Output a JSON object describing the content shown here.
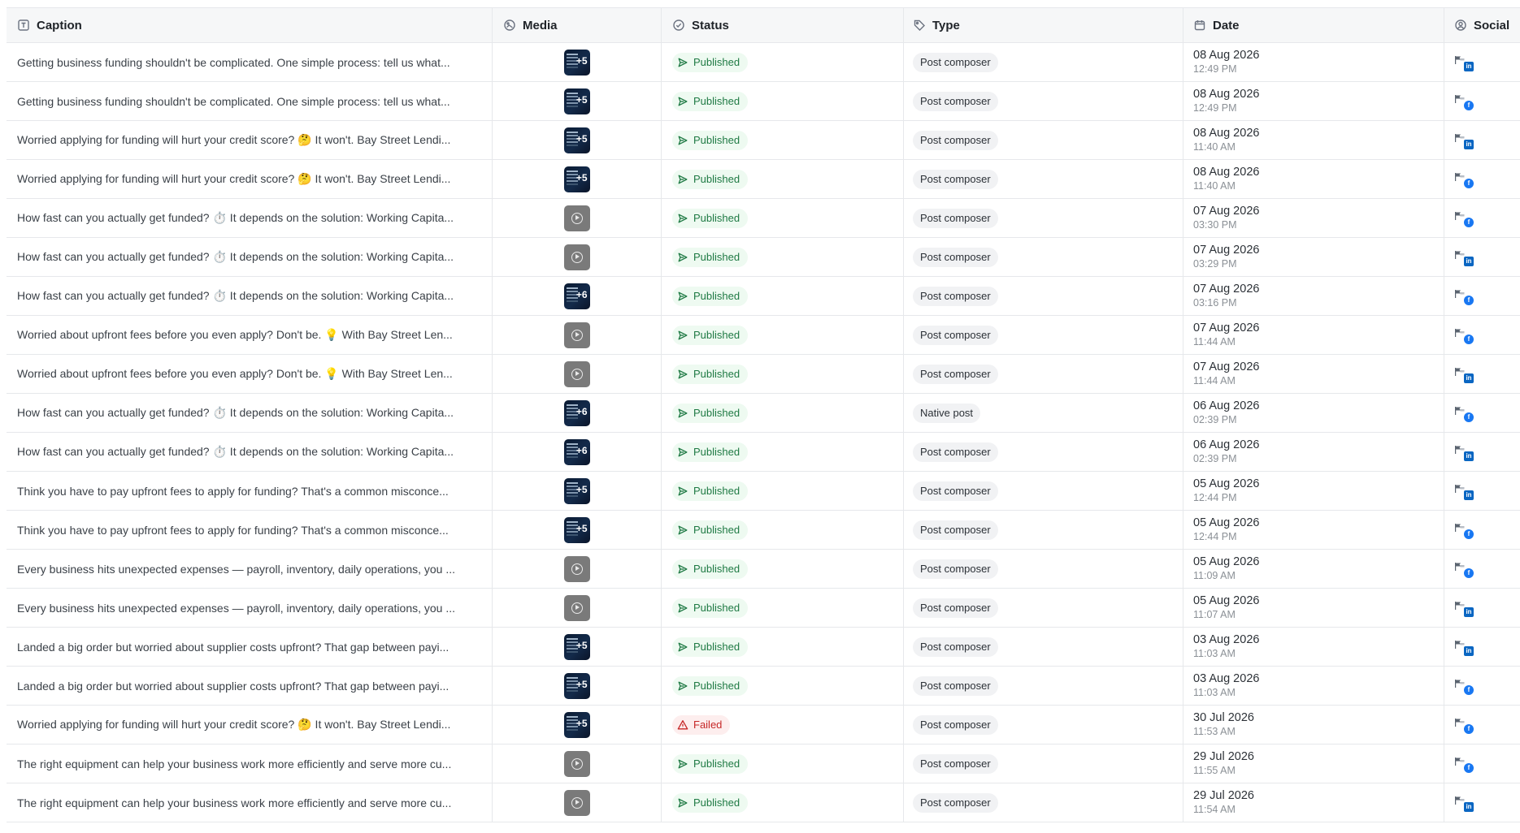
{
  "columns": {
    "caption": "Caption",
    "media": "Media",
    "status": "Status",
    "type": "Type",
    "date": "Date",
    "social": "Social"
  },
  "colors": {
    "accent_green": "#1f7a44",
    "failed_red": "#c62828",
    "linkedin": "#0a66c2",
    "facebook": "#1877f2"
  },
  "rows": [
    {
      "caption": "Getting business funding shouldn't be complicated. One simple process: tell us what...",
      "media": {
        "kind": "image",
        "count": "+5"
      },
      "status": "Published",
      "status_kind": "published",
      "type": "Post composer",
      "date": "08 Aug 2026",
      "time": "12:49 PM",
      "network": "linkedin"
    },
    {
      "caption": "Getting business funding shouldn't be complicated. One simple process: tell us what...",
      "media": {
        "kind": "image",
        "count": "+5"
      },
      "status": "Published",
      "status_kind": "published",
      "type": "Post composer",
      "date": "08 Aug 2026",
      "time": "12:49 PM",
      "network": "facebook"
    },
    {
      "caption": "Worried applying for funding will hurt your credit score? 🤔 It won't. Bay Street Lendi...",
      "media": {
        "kind": "image",
        "count": "+5"
      },
      "status": "Published",
      "status_kind": "published",
      "type": "Post composer",
      "date": "08 Aug 2026",
      "time": "11:40 AM",
      "network": "linkedin"
    },
    {
      "caption": "Worried applying for funding will hurt your credit score? 🤔 It won't. Bay Street Lendi...",
      "media": {
        "kind": "image",
        "count": "+5"
      },
      "status": "Published",
      "status_kind": "published",
      "type": "Post composer",
      "date": "08 Aug 2026",
      "time": "11:40 AM",
      "network": "facebook"
    },
    {
      "caption": "How fast can you actually get funded? ⏱️ It depends on the solution: Working Capita...",
      "media": {
        "kind": "video",
        "count": ""
      },
      "status": "Published",
      "status_kind": "published",
      "type": "Post composer",
      "date": "07 Aug 2026",
      "time": "03:30 PM",
      "network": "facebook"
    },
    {
      "caption": "How fast can you actually get funded? ⏱️ It depends on the solution: Working Capita...",
      "media": {
        "kind": "video",
        "count": ""
      },
      "status": "Published",
      "status_kind": "published",
      "type": "Post composer",
      "date": "07 Aug 2026",
      "time": "03:29 PM",
      "network": "linkedin"
    },
    {
      "caption": "How fast can you actually get funded? ⏱️ It depends on the solution: Working Capita...",
      "media": {
        "kind": "image",
        "count": "+6"
      },
      "status": "Published",
      "status_kind": "published",
      "type": "Post composer",
      "date": "07 Aug 2026",
      "time": "03:16 PM",
      "network": "facebook"
    },
    {
      "caption": "Worried about upfront fees before you even apply? Don't be. 💡 With Bay Street Len...",
      "media": {
        "kind": "video",
        "count": ""
      },
      "status": "Published",
      "status_kind": "published",
      "type": "Post composer",
      "date": "07 Aug 2026",
      "time": "11:44 AM",
      "network": "facebook"
    },
    {
      "caption": "Worried about upfront fees before you even apply? Don't be. 💡 With Bay Street Len...",
      "media": {
        "kind": "video",
        "count": ""
      },
      "status": "Published",
      "status_kind": "published",
      "type": "Post composer",
      "date": "07 Aug 2026",
      "time": "11:44 AM",
      "network": "linkedin"
    },
    {
      "caption": "How fast can you actually get funded? ⏱️ It depends on the solution: Working Capita...",
      "media": {
        "kind": "image",
        "count": "+6"
      },
      "status": "Published",
      "status_kind": "published",
      "type": "Native post",
      "date": "06 Aug 2026",
      "time": "02:39 PM",
      "network": "facebook"
    },
    {
      "caption": "How fast can you actually get funded? ⏱️ It depends on the solution: Working Capita...",
      "media": {
        "kind": "image",
        "count": "+6"
      },
      "status": "Published",
      "status_kind": "published",
      "type": "Post composer",
      "date": "06 Aug 2026",
      "time": "02:39 PM",
      "network": "linkedin"
    },
    {
      "caption": "Think you have to pay upfront fees to apply for funding? That's a common misconce...",
      "media": {
        "kind": "image",
        "count": "+5"
      },
      "status": "Published",
      "status_kind": "published",
      "type": "Post composer",
      "date": "05 Aug 2026",
      "time": "12:44 PM",
      "network": "linkedin"
    },
    {
      "caption": "Think you have to pay upfront fees to apply for funding? That's a common misconce...",
      "media": {
        "kind": "image",
        "count": "+5"
      },
      "status": "Published",
      "status_kind": "published",
      "type": "Post composer",
      "date": "05 Aug 2026",
      "time": "12:44 PM",
      "network": "facebook"
    },
    {
      "caption": "Every business hits unexpected expenses — payroll, inventory, daily operations, you ...",
      "media": {
        "kind": "video",
        "count": ""
      },
      "status": "Published",
      "status_kind": "published",
      "type": "Post composer",
      "date": "05 Aug 2026",
      "time": "11:09 AM",
      "network": "facebook"
    },
    {
      "caption": "Every business hits unexpected expenses — payroll, inventory, daily operations, you ...",
      "media": {
        "kind": "video",
        "count": ""
      },
      "status": "Published",
      "status_kind": "published",
      "type": "Post composer",
      "date": "05 Aug 2026",
      "time": "11:07 AM",
      "network": "linkedin"
    },
    {
      "caption": "Landed a big order but worried about supplier costs upfront? That gap between payi...",
      "media": {
        "kind": "image",
        "count": "+5"
      },
      "status": "Published",
      "status_kind": "published",
      "type": "Post composer",
      "date": "03 Aug 2026",
      "time": "11:03 AM",
      "network": "linkedin"
    },
    {
      "caption": "Landed a big order but worried about supplier costs upfront? That gap between payi...",
      "media": {
        "kind": "image",
        "count": "+5"
      },
      "status": "Published",
      "status_kind": "published",
      "type": "Post composer",
      "date": "03 Aug 2026",
      "time": "11:03 AM",
      "network": "facebook"
    },
    {
      "caption": "Worried applying for funding will hurt your credit score? 🤔 It won't. Bay Street Lendi...",
      "media": {
        "kind": "image",
        "count": "+5"
      },
      "status": "Failed",
      "status_kind": "failed",
      "type": "Post composer",
      "date": "30 Jul 2026",
      "time": "11:53 AM",
      "network": "facebook"
    },
    {
      "caption": "The right equipment can help your business work more efficiently and serve more cu...",
      "media": {
        "kind": "video",
        "count": ""
      },
      "status": "Published",
      "status_kind": "published",
      "type": "Post composer",
      "date": "29 Jul 2026",
      "time": "11:55 AM",
      "network": "facebook"
    },
    {
      "caption": "The right equipment can help your business work more efficiently and serve more cu...",
      "media": {
        "kind": "video",
        "count": ""
      },
      "status": "Published",
      "status_kind": "published",
      "type": "Post composer",
      "date": "29 Jul 2026",
      "time": "11:54 AM",
      "network": "linkedin"
    }
  ]
}
